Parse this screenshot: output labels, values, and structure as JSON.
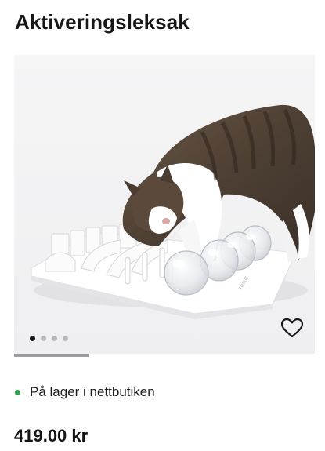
{
  "product": {
    "title": "Aktiveringsleksak",
    "image_alt": "Cat playing with white activity board with transparent domes",
    "gallery": {
      "image_count": 4,
      "active_index": 0,
      "scroll_progress": 0.25
    },
    "favorite_icon": "heart-outline-icon",
    "stock": {
      "status_color": "#2fa34a",
      "label": "På lager i nettbutiken"
    },
    "price": "419.00 kr"
  }
}
